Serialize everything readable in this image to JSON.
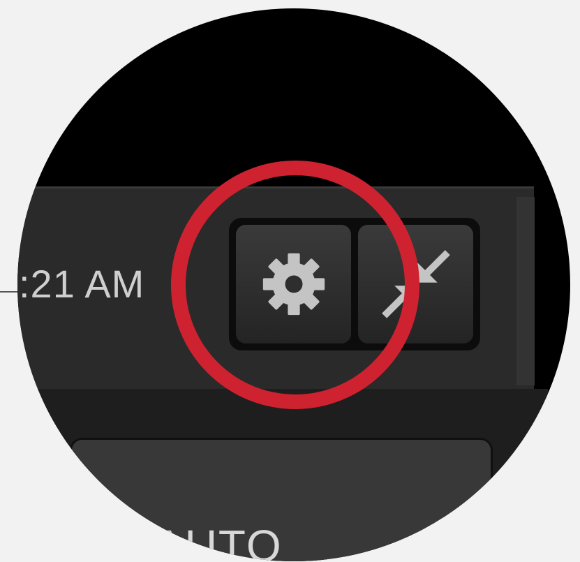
{
  "toolbar": {
    "clock_text": ":21 AM",
    "settings_button": {
      "icon": "gear-icon"
    },
    "collapse_button": {
      "icon": "collapse-arrows-icon"
    }
  },
  "panel": {
    "label": "AUTO"
  },
  "highlight": {
    "color": "#cf2230",
    "target": "settings-button"
  },
  "colors": {
    "background": "#f2f2f2",
    "toolbar": "#2a2a2a",
    "icon": "#c4c4c4"
  }
}
